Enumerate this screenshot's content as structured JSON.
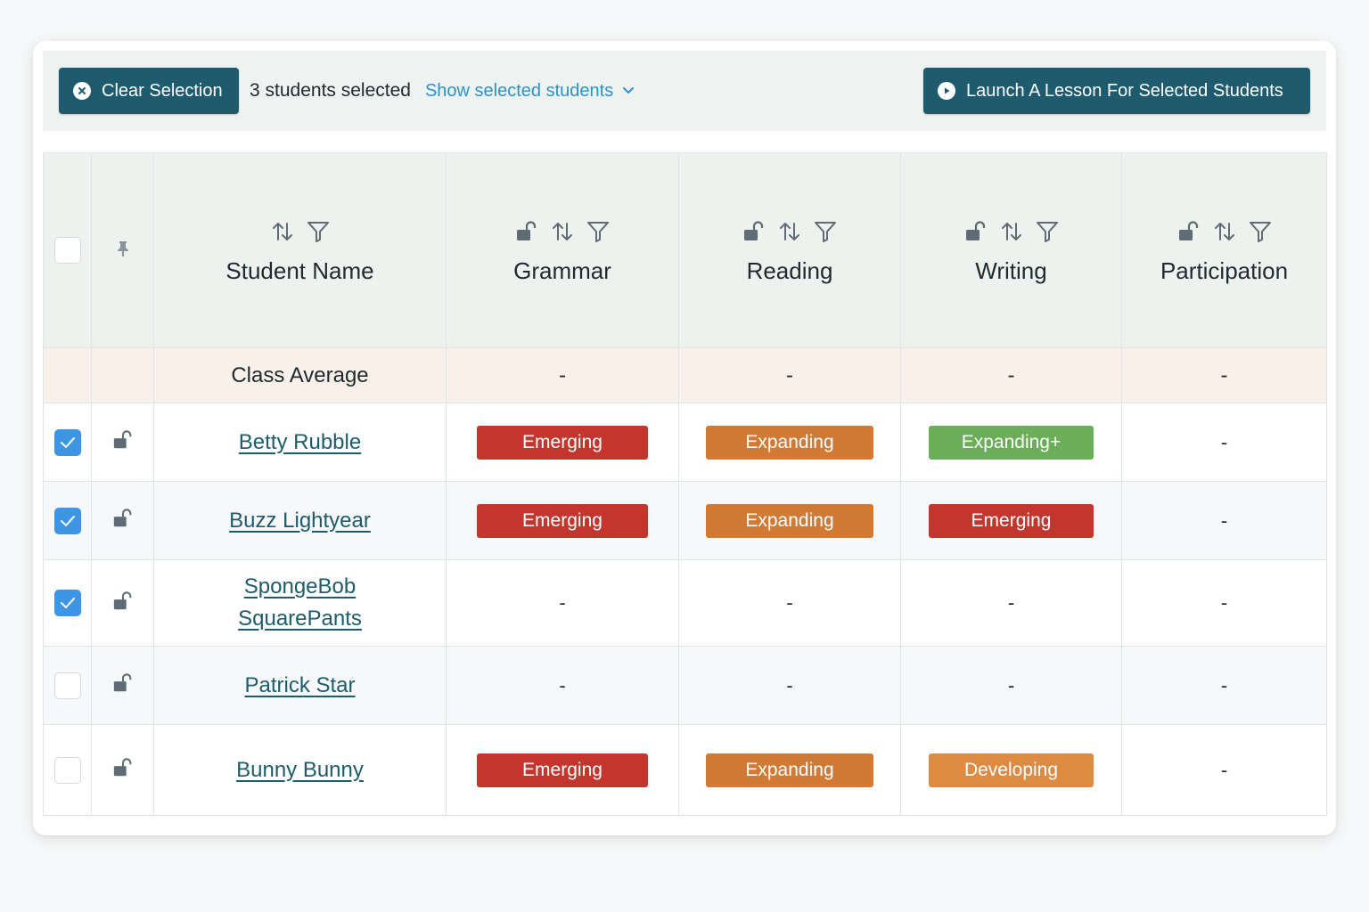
{
  "toolbar": {
    "clear_label": "Clear Selection",
    "selected_count": "3 students selected",
    "show_selected": "Show selected students",
    "launch_label": "Launch A Lesson For Selected Students"
  },
  "columns": {
    "student_name": "Student Name",
    "grammar": "Grammar",
    "reading": "Reading",
    "writing": "Writing",
    "participation": "Participation"
  },
  "class_average": {
    "label": "Class Average",
    "grammar": "-",
    "reading": "-",
    "writing": "-",
    "participation": "-"
  },
  "students": [
    {
      "name": "Betty Rubble",
      "selected": true,
      "grammar": "Emerging",
      "reading": "Expanding",
      "writing": "Expanding+",
      "participation": "-"
    },
    {
      "name": "Buzz Lightyear",
      "selected": true,
      "grammar": "Emerging",
      "reading": "Expanding",
      "writing": "Emerging",
      "participation": "-"
    },
    {
      "name_line1": "SpongeBob",
      "name_line2": "SquarePants",
      "selected": true,
      "grammar": "-",
      "reading": "-",
      "writing": "-",
      "participation": "-"
    },
    {
      "name": "Patrick Star",
      "selected": false,
      "grammar": "-",
      "reading": "-",
      "writing": "-",
      "participation": "-"
    },
    {
      "name": "Bunny Bunny",
      "selected": false,
      "grammar": "Emerging",
      "reading": "Expanding",
      "writing": "Developing",
      "participation": "-"
    }
  ],
  "colors": {
    "primary_button": "#1e5b6f",
    "link": "#2b93cc",
    "checkbox_checked": "#3d95e6",
    "emerging": "#c2362e",
    "expanding": "#d07a35",
    "expanding_plus": "#6aae58",
    "developing": "#dd8a42"
  },
  "icons": {
    "clear": "close-circle-icon",
    "launch": "play-circle-icon",
    "sort": "sort-icon",
    "filter": "filter-icon",
    "lock": "unlock-icon",
    "pin": "pin-icon",
    "chevron": "chevron-down-icon"
  }
}
